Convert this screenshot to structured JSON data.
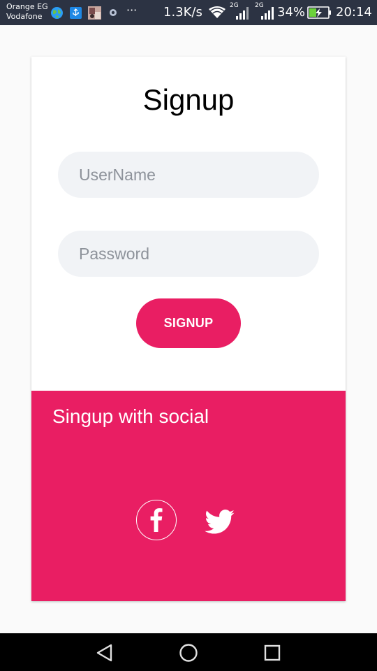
{
  "status_bar": {
    "carrier_1": "Orange EG",
    "carrier_2": "Vodafone",
    "more": "···",
    "speed": "1.3K/s",
    "sim1_net": "2G",
    "sim2_net": "2G",
    "battery": "34%",
    "time": "20:14",
    "background_color": "#2c3343"
  },
  "form": {
    "title": "Signup",
    "username_placeholder": "UserName",
    "password_placeholder": "Password",
    "signup_label": "SIGNUP"
  },
  "social": {
    "title": "Singup with social",
    "icons": [
      "facebook-icon",
      "twitter-icon"
    ]
  },
  "nav": {
    "icons": [
      "back-icon",
      "home-icon",
      "recents-icon"
    ]
  },
  "colors": {
    "accent": "#e91e63",
    "input_background": "#f1f3f6",
    "page_background": "#fafafa"
  }
}
